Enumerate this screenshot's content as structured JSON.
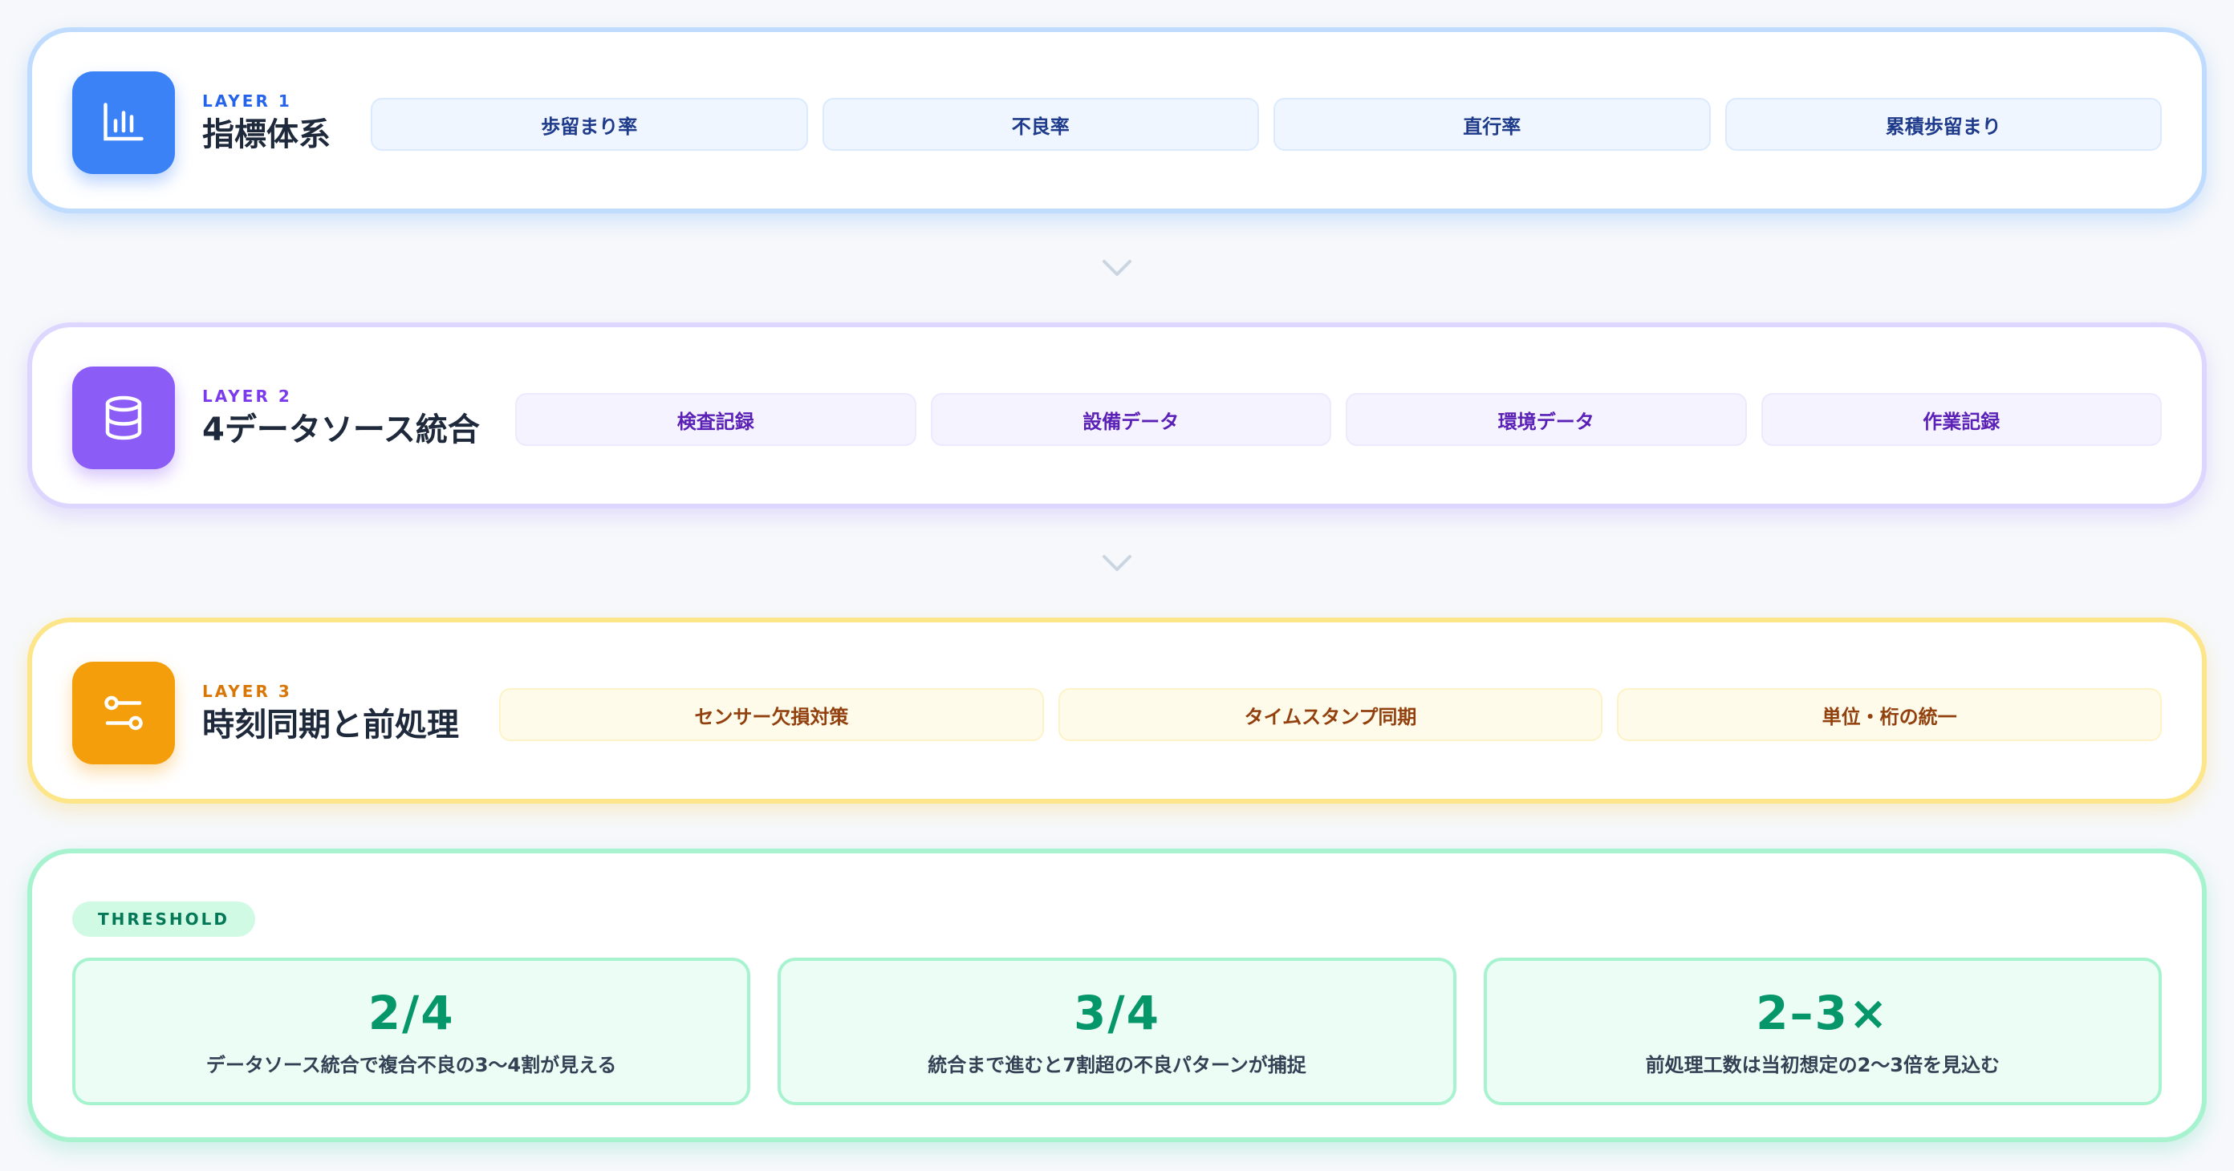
{
  "layers": [
    {
      "tag": "LAYER 1",
      "title": "指標体系",
      "icon": "bar-chart-icon",
      "accent": "#3b82f6",
      "chips": [
        "歩留まり率",
        "不良率",
        "直行率",
        "累積歩留まり"
      ]
    },
    {
      "tag": "LAYER 2",
      "title": "4データソース統合",
      "icon": "database-icon",
      "accent": "#8b5cf6",
      "chips": [
        "検査記録",
        "設備データ",
        "環境データ",
        "作業記録"
      ]
    },
    {
      "tag": "LAYER 3",
      "title": "時刻同期と前処理",
      "icon": "toggles-icon",
      "accent": "#f59e0b",
      "chips": [
        "センサー欠損対策",
        "タイムスタンプ同期",
        "単位・桁の統一"
      ]
    }
  ],
  "threshold": {
    "badge": "THRESHOLD",
    "accent": "#059669",
    "stats": [
      {
        "value": "2/4",
        "label": "データソース統合で複合不良の3〜4割が見える"
      },
      {
        "value": "3/4",
        "label": "統合まで進むと7割超の不良パターンが捕捉"
      },
      {
        "value": "2–3×",
        "label": "前処理工数は当初想定の2〜3倍を見込む"
      }
    ]
  }
}
